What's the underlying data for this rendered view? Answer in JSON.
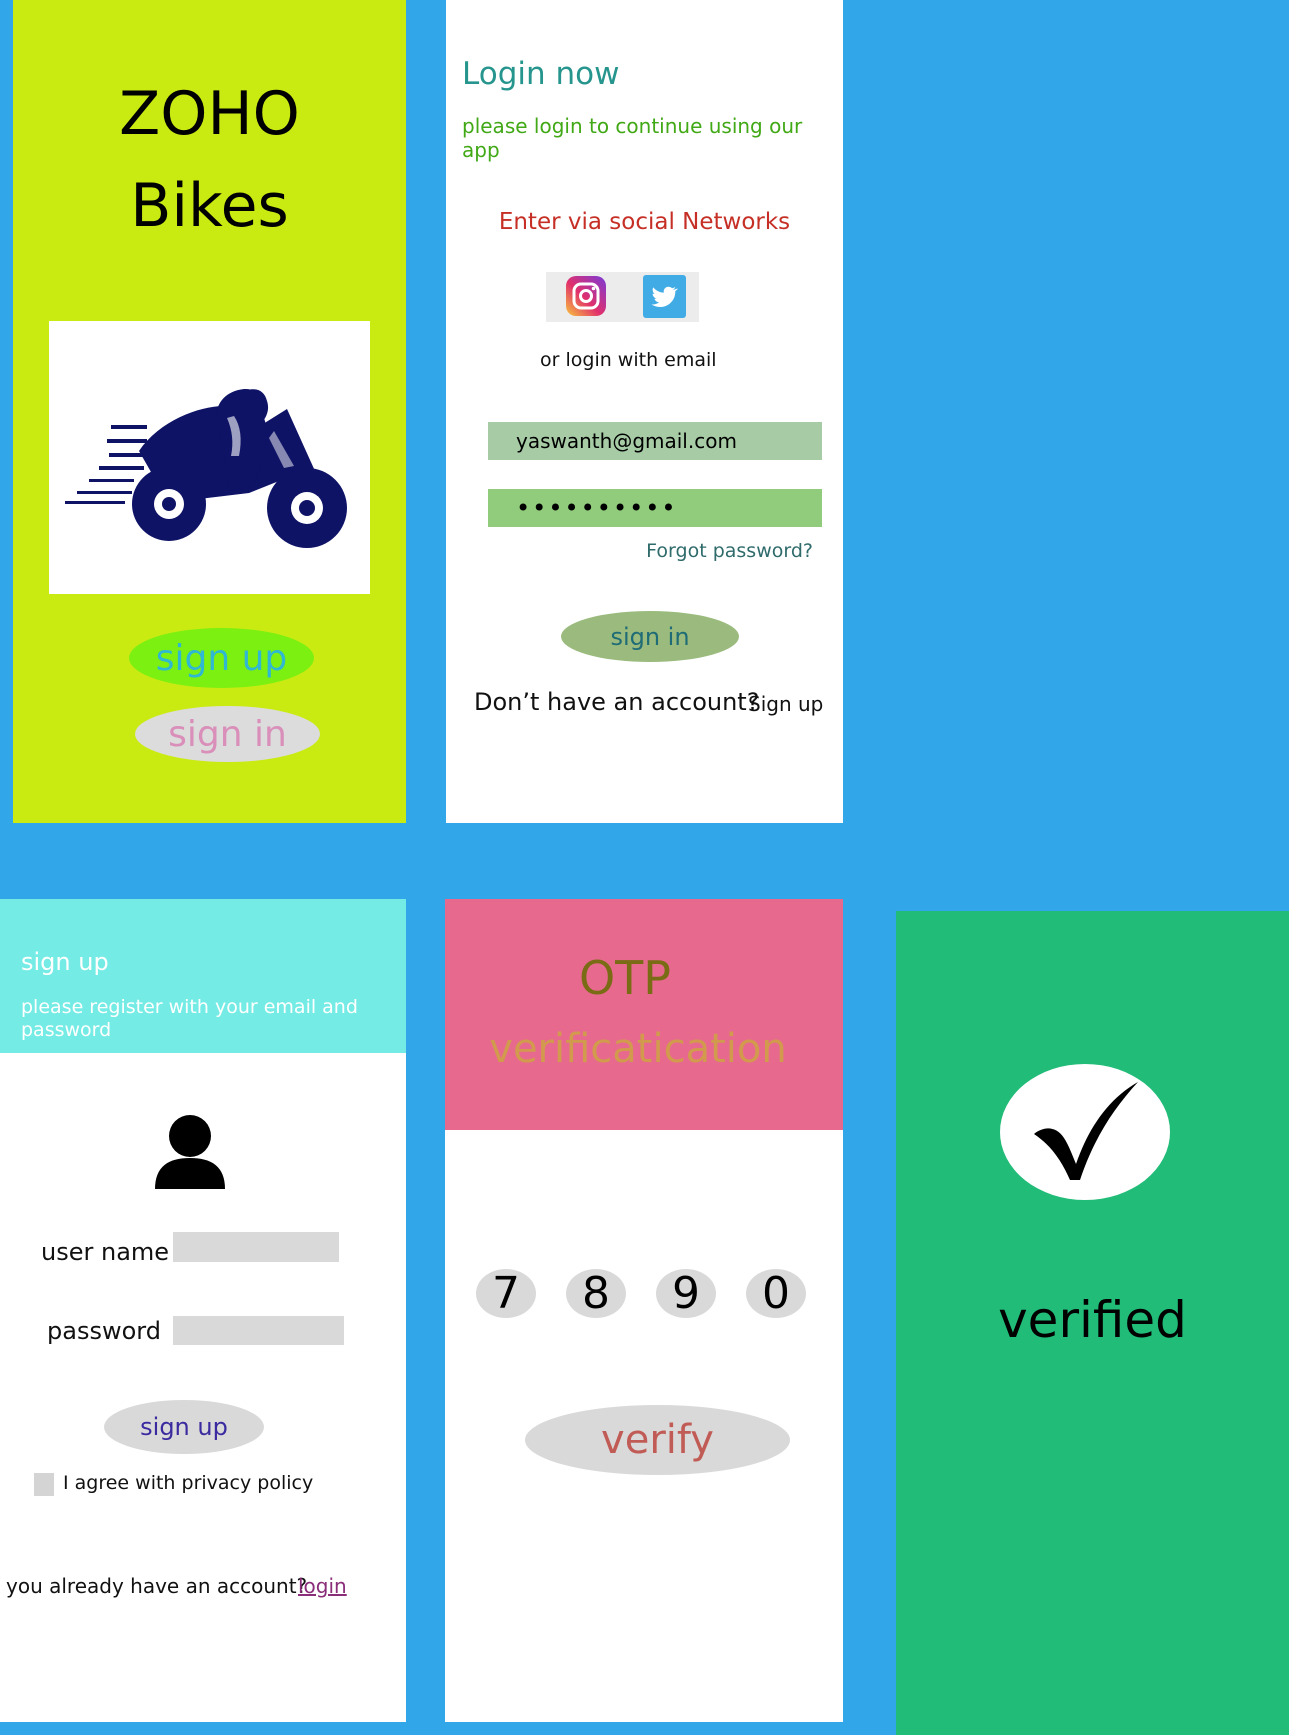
{
  "colors": {
    "background": "#31a6e9",
    "splash_bg": "#caeb12",
    "signup_header": "#75ebe5",
    "otp_header": "#e76a8e",
    "verified_bg": "#21bc78"
  },
  "splash": {
    "brand_line1": "ZOHO",
    "brand_line2": "Bikes",
    "logo_icon": "motorcycle-rider-icon",
    "signup_label": "sign up",
    "signin_label": "sign in"
  },
  "login": {
    "title": "Login now",
    "subtitle": "please login to continue using our app",
    "social_label": "Enter via social Networks",
    "social_icons": [
      "instagram-icon",
      "twitter-icon"
    ],
    "or_email": "or login with email",
    "email_value": "yaswanth@gmail.com",
    "password_value": "••••••••••",
    "forgot": "Forgot password?",
    "signin_label": "sign in",
    "no_account": "Don’t have an account?",
    "signup_link": "Sign up"
  },
  "signup": {
    "title": "sign up",
    "subtitle": "please register with your email and password",
    "user_icon": "user-icon",
    "username_label": "user name",
    "password_label": "password",
    "signup_label": "sign up",
    "agree": "I agree with privacy policy",
    "have_account": "you already have an account?",
    "login_link": "login"
  },
  "otp": {
    "title": "OTP",
    "subtitle": "verificatication",
    "digits": [
      "7",
      "8",
      "9",
      "0"
    ],
    "verify_label": "verify"
  },
  "verified": {
    "check_icon": "checkmark-icon",
    "label": "verified"
  }
}
